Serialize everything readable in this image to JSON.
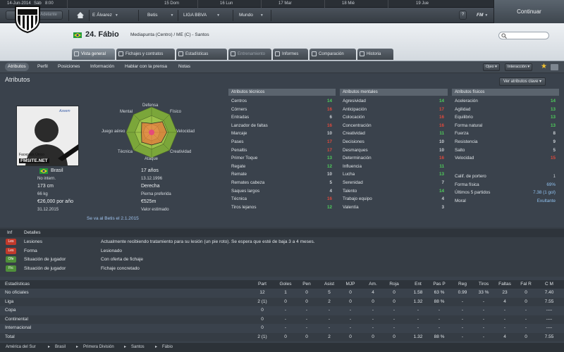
{
  "calendar": {
    "date": "14-Jun-2014",
    "day": "Sáb",
    "time": "8:00",
    "days": [
      "15 Dom",
      "16 Lun",
      "17 Mar",
      "18 Mié",
      "19 Jue"
    ]
  },
  "toolbar": {
    "back": "Atrás",
    "forward": "Adelante",
    "manager": "E Álvarez",
    "club": "Betis",
    "league": "LIGA BBVA",
    "world": "Mundo",
    "help": "?",
    "fm": "FM",
    "continue": "Continuar"
  },
  "player": {
    "number_name": "24. Fábio",
    "position_club": "Mediapunta (Centro) / ME (C) - Santos"
  },
  "tabs": [
    "Vista general",
    "Fichajes y contratos",
    "Estadísticas",
    "Entrenamiento",
    "Informes",
    "Comparación",
    "Historia"
  ],
  "subnav": {
    "items": [
      "Atributos",
      "Perfil",
      "Posiciones",
      "Información",
      "Hablar con la prensa",
      "Notas"
    ],
    "ojeo": "Ojeo",
    "interaccion": "Interacción"
  },
  "attributes": {
    "title": "Atributos",
    "view_button": "Ver atributos clave",
    "radar_labels": {
      "defensa": "Defensa",
      "fisico": "Físico",
      "velocidad": "Velocidad",
      "creatividad": "Creatividad",
      "ataque": "Ataque",
      "tecnica": "Técnica",
      "juego_aereo": "Juego aéreo",
      "mental": "Mental"
    },
    "radar_values": {
      "defensa": 0.35,
      "fisico": 0.6,
      "velocidad": 0.6,
      "creatividad": 0.55,
      "ataque": 0.5,
      "tecnica": 0.55,
      "juego_aereo": 0.4,
      "mental": 0.55
    },
    "photo_caption": "Facepack Único",
    "photo_watermark": "FMSITE.NET",
    "nationality": "Brasil",
    "age": "17 años",
    "intl": "No intern.",
    "dob": "13.12.1996",
    "height": "173 cm",
    "foot": "Derecha",
    "weight": "66 kg",
    "foot_label": "Pierna preferida",
    "wage": "€26,000 por año",
    "value": "€525m",
    "contract_end": "31.12.2015",
    "value_label": "Valor estimado",
    "seen_at": "Se va al Betis el 2.1.2015",
    "technical_title": "Atributos técnicos",
    "mental_title": "Atributos mentales",
    "physical_title": "Atributos físicos",
    "technical": [
      {
        "name": "Centros",
        "value": "14"
      },
      {
        "name": "Córners",
        "value": "16"
      },
      {
        "name": "Entradas",
        "value": "6"
      },
      {
        "name": "Lanzador de faltas",
        "value": "16"
      },
      {
        "name": "Marcaje",
        "value": "10"
      },
      {
        "name": "Pases",
        "value": "17"
      },
      {
        "name": "Penaltis",
        "value": "17"
      },
      {
        "name": "Primer Toque",
        "value": "13"
      },
      {
        "name": "Regate",
        "value": "12"
      },
      {
        "name": "Remate",
        "value": "10"
      },
      {
        "name": "Remates cabeza",
        "value": "5"
      },
      {
        "name": "Saques largos",
        "value": "4"
      },
      {
        "name": "Técnica",
        "value": "16"
      },
      {
        "name": "Tiros lejanos",
        "value": "12"
      }
    ],
    "mental": [
      {
        "name": "Agresividad",
        "value": "14"
      },
      {
        "name": "Anticipación",
        "value": "17"
      },
      {
        "name": "Colocación",
        "value": "16"
      },
      {
        "name": "Concentración",
        "value": "16"
      },
      {
        "name": "Creatividad",
        "value": "11"
      },
      {
        "name": "Decisiones",
        "value": "10"
      },
      {
        "name": "Desmarques",
        "value": "10"
      },
      {
        "name": "Determinación",
        "value": "16"
      },
      {
        "name": "Influencia",
        "value": "11"
      },
      {
        "name": "Lucha",
        "value": "13"
      },
      {
        "name": "Serenidad",
        "value": "7"
      },
      {
        "name": "Talento",
        "value": "14"
      },
      {
        "name": "Trabajo equipo",
        "value": "4"
      },
      {
        "name": "Valentía",
        "value": "3"
      }
    ],
    "physical": [
      {
        "name": "Aceleración",
        "value": "14"
      },
      {
        "name": "Agilidad",
        "value": "13"
      },
      {
        "name": "Equilibrio",
        "value": "13"
      },
      {
        "name": "Forma natural",
        "value": "13"
      },
      {
        "name": "Fuerza",
        "value": "8"
      },
      {
        "name": "Resistencia",
        "value": "9"
      },
      {
        "name": "Salto",
        "value": "5"
      },
      {
        "name": "Velocidad",
        "value": "15"
      }
    ],
    "physical_extra": [
      {
        "name": "Calif. de portero",
        "value": "1"
      },
      {
        "name": "Forma física",
        "value": "69%"
      },
      {
        "name": "Últimos 5 partidos",
        "value": "7.38 (1 gol)"
      },
      {
        "name": "Moral",
        "value": "Exultante"
      }
    ]
  },
  "info": {
    "col1": "Inf",
    "col2": "Detalles",
    "rows": [
      {
        "badge": "Les",
        "label": "Lesiones",
        "detail": "Actualmente recibiendo tratamiento para su lesión (un pie roto). Se espera que esté de baja 3 a 4 meses.",
        "color": "#c0392b"
      },
      {
        "badge": "Les",
        "label": "Forma",
        "detail": "Lesionado",
        "color": "#c0392b"
      },
      {
        "badge": "Ofe",
        "label": "Situación de jugador",
        "detail": "Con oferta de fichaje",
        "color": "#4f8f3a"
      },
      {
        "badge": "Fic",
        "label": "Situación de jugador",
        "detail": "Fichaje concretado",
        "color": "#4f8f3a"
      }
    ]
  },
  "stats": {
    "title": "Estadísticas",
    "headers": [
      "Part",
      "Goles",
      "Pen",
      "Asist",
      "MJP",
      "Am.",
      "Roja",
      "Ent",
      "Pas P",
      "Reg",
      "Tiros",
      "Faltas",
      "Fal R",
      "C M"
    ],
    "rows": [
      {
        "label": "No oficiales",
        "cells": [
          "12",
          "1",
          "0",
          "5",
          "0",
          "4",
          "0",
          "1.58",
          "63 %",
          "0.99",
          "33 %",
          "23",
          "0",
          "7.40"
        ]
      },
      {
        "label": "Liga",
        "cells": [
          "2 (1)",
          "0",
          "0",
          "2",
          "0",
          "0",
          "0",
          "1.32",
          "88 %",
          "-",
          "-",
          "4",
          "0",
          "7.55"
        ]
      },
      {
        "label": "Copa",
        "cells": [
          "0",
          "-",
          "-",
          "-",
          "-",
          "-",
          "-",
          "-",
          "-",
          "-",
          "-",
          "-",
          "-",
          "----"
        ]
      },
      {
        "label": "Continental",
        "cells": [
          "0",
          "-",
          "-",
          "-",
          "-",
          "-",
          "-",
          "-",
          "-",
          "-",
          "-",
          "-",
          "-",
          "----"
        ]
      },
      {
        "label": "Internacional",
        "cells": [
          "0",
          "-",
          "-",
          "-",
          "-",
          "-",
          "-",
          "-",
          "-",
          "-",
          "-",
          "-",
          "-",
          "----"
        ]
      },
      {
        "label": "Total",
        "cells": [
          "2 (1)",
          "0",
          "0",
          "2",
          "0",
          "0",
          "0",
          "1.32",
          "88 %",
          "-",
          "-",
          "4",
          "0",
          "7.55"
        ]
      }
    ]
  },
  "breadcrumb": [
    "América del Sur",
    "Brasil",
    "Primera División",
    "Santos",
    "Fábio"
  ],
  "colors": {
    "green": "#4fd05b",
    "red": "#e04a3c",
    "white": "#dde2e6"
  }
}
